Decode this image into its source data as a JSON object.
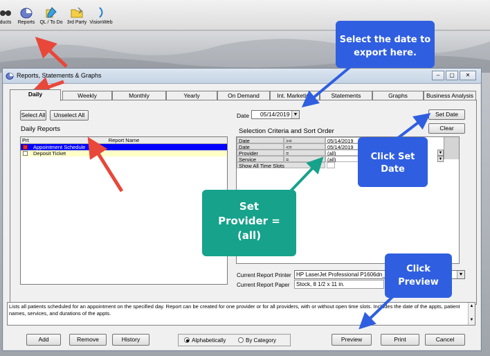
{
  "toolbar": {
    "items": [
      {
        "label": "ducts",
        "icon": "products-icon"
      },
      {
        "label": "Reports",
        "icon": "reports-icon"
      },
      {
        "label": "QL / To Do",
        "icon": "todo-icon"
      },
      {
        "label": "3rd Party",
        "icon": "folder-icon"
      },
      {
        "label": "VisionWeb",
        "icon": "visionweb-icon"
      }
    ]
  },
  "window": {
    "title": "Reports, Statements & Graphs",
    "controls": [
      "–",
      "▢",
      "✕"
    ]
  },
  "tabs": [
    {
      "label": "Daily",
      "active": true
    },
    {
      "label": "Weekly"
    },
    {
      "label": "Monthly"
    },
    {
      "label": "Yearly"
    },
    {
      "label": "On Demand"
    },
    {
      "label": "Int. Marketing"
    },
    {
      "label": "Statements"
    },
    {
      "label": "Graphs"
    },
    {
      "label": "Business Analysis"
    }
  ],
  "left": {
    "select_all": "Select All",
    "unselect_all": "Unselect All",
    "section_label": "Daily Reports",
    "list_header": {
      "prt": "Prt",
      "name": "Report Name"
    },
    "rows": [
      {
        "name": "Appointment Schedule",
        "checked": true,
        "selected": true
      },
      {
        "name": "Deposit Ticket",
        "checked": false,
        "selected": false
      }
    ]
  },
  "right": {
    "date_label": "Date",
    "date_value": "05/14/2019",
    "set_date": "Set Date",
    "clear": "Clear",
    "criteria_label": "Selection Criteria and Sort Order",
    "criteria": [
      {
        "field": "Date",
        "op": ">=",
        "value": "05/14/2019"
      },
      {
        "field": "Date",
        "op": "<=",
        "value": "05/14/2019"
      },
      {
        "field": "Provider",
        "op": "=",
        "value": "(all)"
      },
      {
        "field": "Service",
        "op": "=",
        "value": "(all)"
      },
      {
        "field": "Show All Time Slots",
        "op": "",
        "value": ""
      }
    ],
    "printer_label": "Current Report Printer",
    "printer_value": "HP LaserJet Professional P1606dn_1",
    "paper_label": "Current Report Paper",
    "paper_value": "Stock, 8 1/2 x 11 in."
  },
  "description": "Lists all patients scheduled for an appointment on the specified day. Report can be created for one provider or for all providers, with or without open time slots. Includes the date of the appts, patient names, services, and durations of the appts.",
  "bottom": {
    "add": "Add",
    "remove": "Remove",
    "history": "History",
    "sort_alpha": "Alphabetically",
    "sort_category": "By Category",
    "sort_selected": "alpha",
    "preview": "Preview",
    "print": "Print",
    "cancel": "Cancel"
  },
  "callouts": {
    "date": "Select the date to export here.",
    "set_date": "Click Set Date",
    "provider_line1": "Set",
    "provider_line2": "Provider =",
    "provider_line3": "(all)",
    "preview": "Click Preview"
  },
  "colors": {
    "callout_blue": "#2f5fe0",
    "callout_teal": "#16a28b",
    "arrow_red": "#e8473a",
    "selected_row": "#0000ff",
    "deposit_row": "#ffffc8"
  }
}
